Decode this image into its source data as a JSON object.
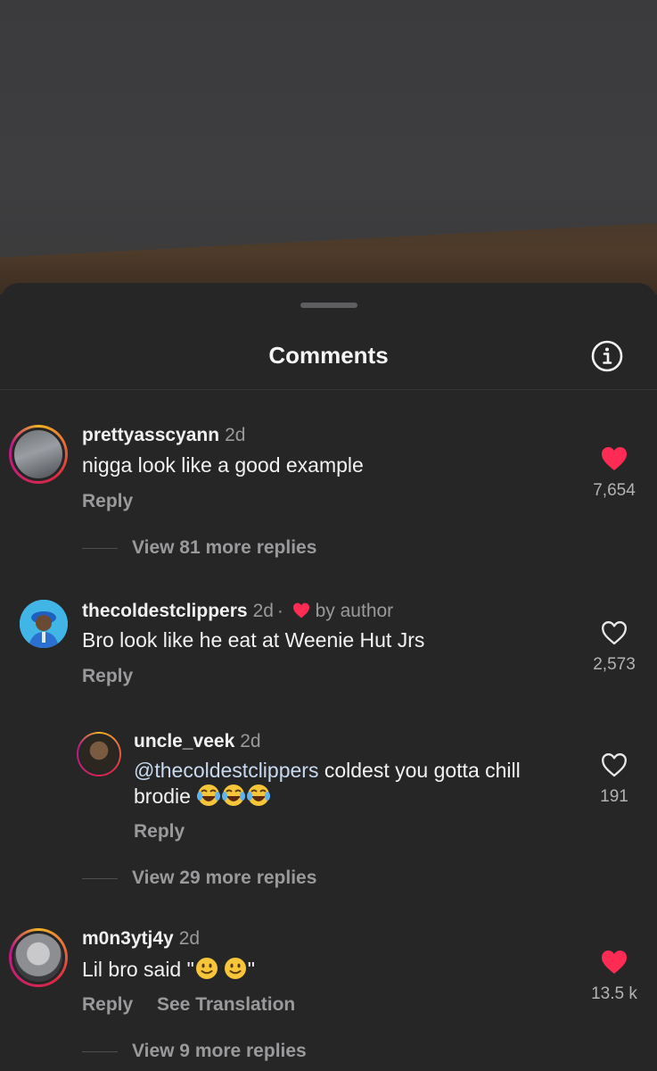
{
  "header": {
    "title": "Comments"
  },
  "colors": {
    "like_red": "#fe2c55",
    "background": "#262627",
    "muted": "#9a9a9c"
  },
  "comments": [
    {
      "username": "prettyasscyann",
      "time": "2d",
      "text": "nigga look like a good example",
      "reply_label": "Reply",
      "liked": true,
      "likes": "7,654",
      "view_more": "View 81 more replies"
    },
    {
      "username": "thecoldestclippers",
      "time": "2d",
      "separator": "·",
      "author_liked": "by author",
      "text": "Bro look like he eat at Weenie Hut Jrs",
      "reply_label": "Reply",
      "liked": false,
      "likes": "2,573"
    },
    {
      "username": "uncle_veek",
      "time": "2d",
      "mention": "@thecoldestclippers",
      "text_after_mention": " coldest you gotta chill",
      "text_line2": "brodie",
      "emojis": [
        "face-with-tears-of-joy",
        "face-with-tears-of-joy",
        "face-with-tears-of-joy"
      ],
      "reply_label": "Reply",
      "liked": false,
      "likes": "191",
      "view_more": "View 29 more replies"
    },
    {
      "username": "m0n3ytj4y",
      "time": "2d",
      "text_before": "Lil bro said \"",
      "emojis": [
        "slightly-smiling-face",
        "slightly-smiling-face"
      ],
      "text_after": "\"",
      "reply_label": "Reply",
      "see_translation": "See Translation",
      "liked": true,
      "likes": "13.5 k",
      "view_more": "View 9 more replies"
    }
  ]
}
